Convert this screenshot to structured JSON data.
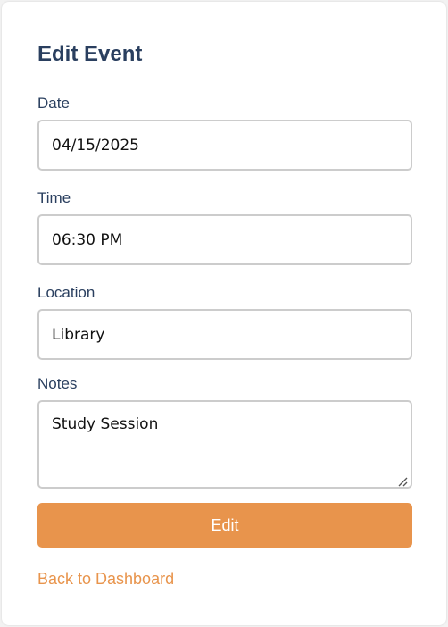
{
  "form": {
    "title": "Edit Event",
    "fields": {
      "date": {
        "label": "Date",
        "value": "04/15/2025"
      },
      "time": {
        "label": "Time",
        "value": "06:30 PM"
      },
      "location": {
        "label": "Location",
        "value": "Library"
      },
      "notes": {
        "label": "Notes",
        "value": "Study Session"
      }
    },
    "submit_label": "Edit",
    "back_link": "Back to Dashboard"
  },
  "colors": {
    "heading": "#2a3f5f",
    "accent": "#e8944c",
    "border": "#cccccc",
    "background": "#ffffff"
  },
  "icons": {
    "notes_resize": "resize-grip-icon"
  }
}
